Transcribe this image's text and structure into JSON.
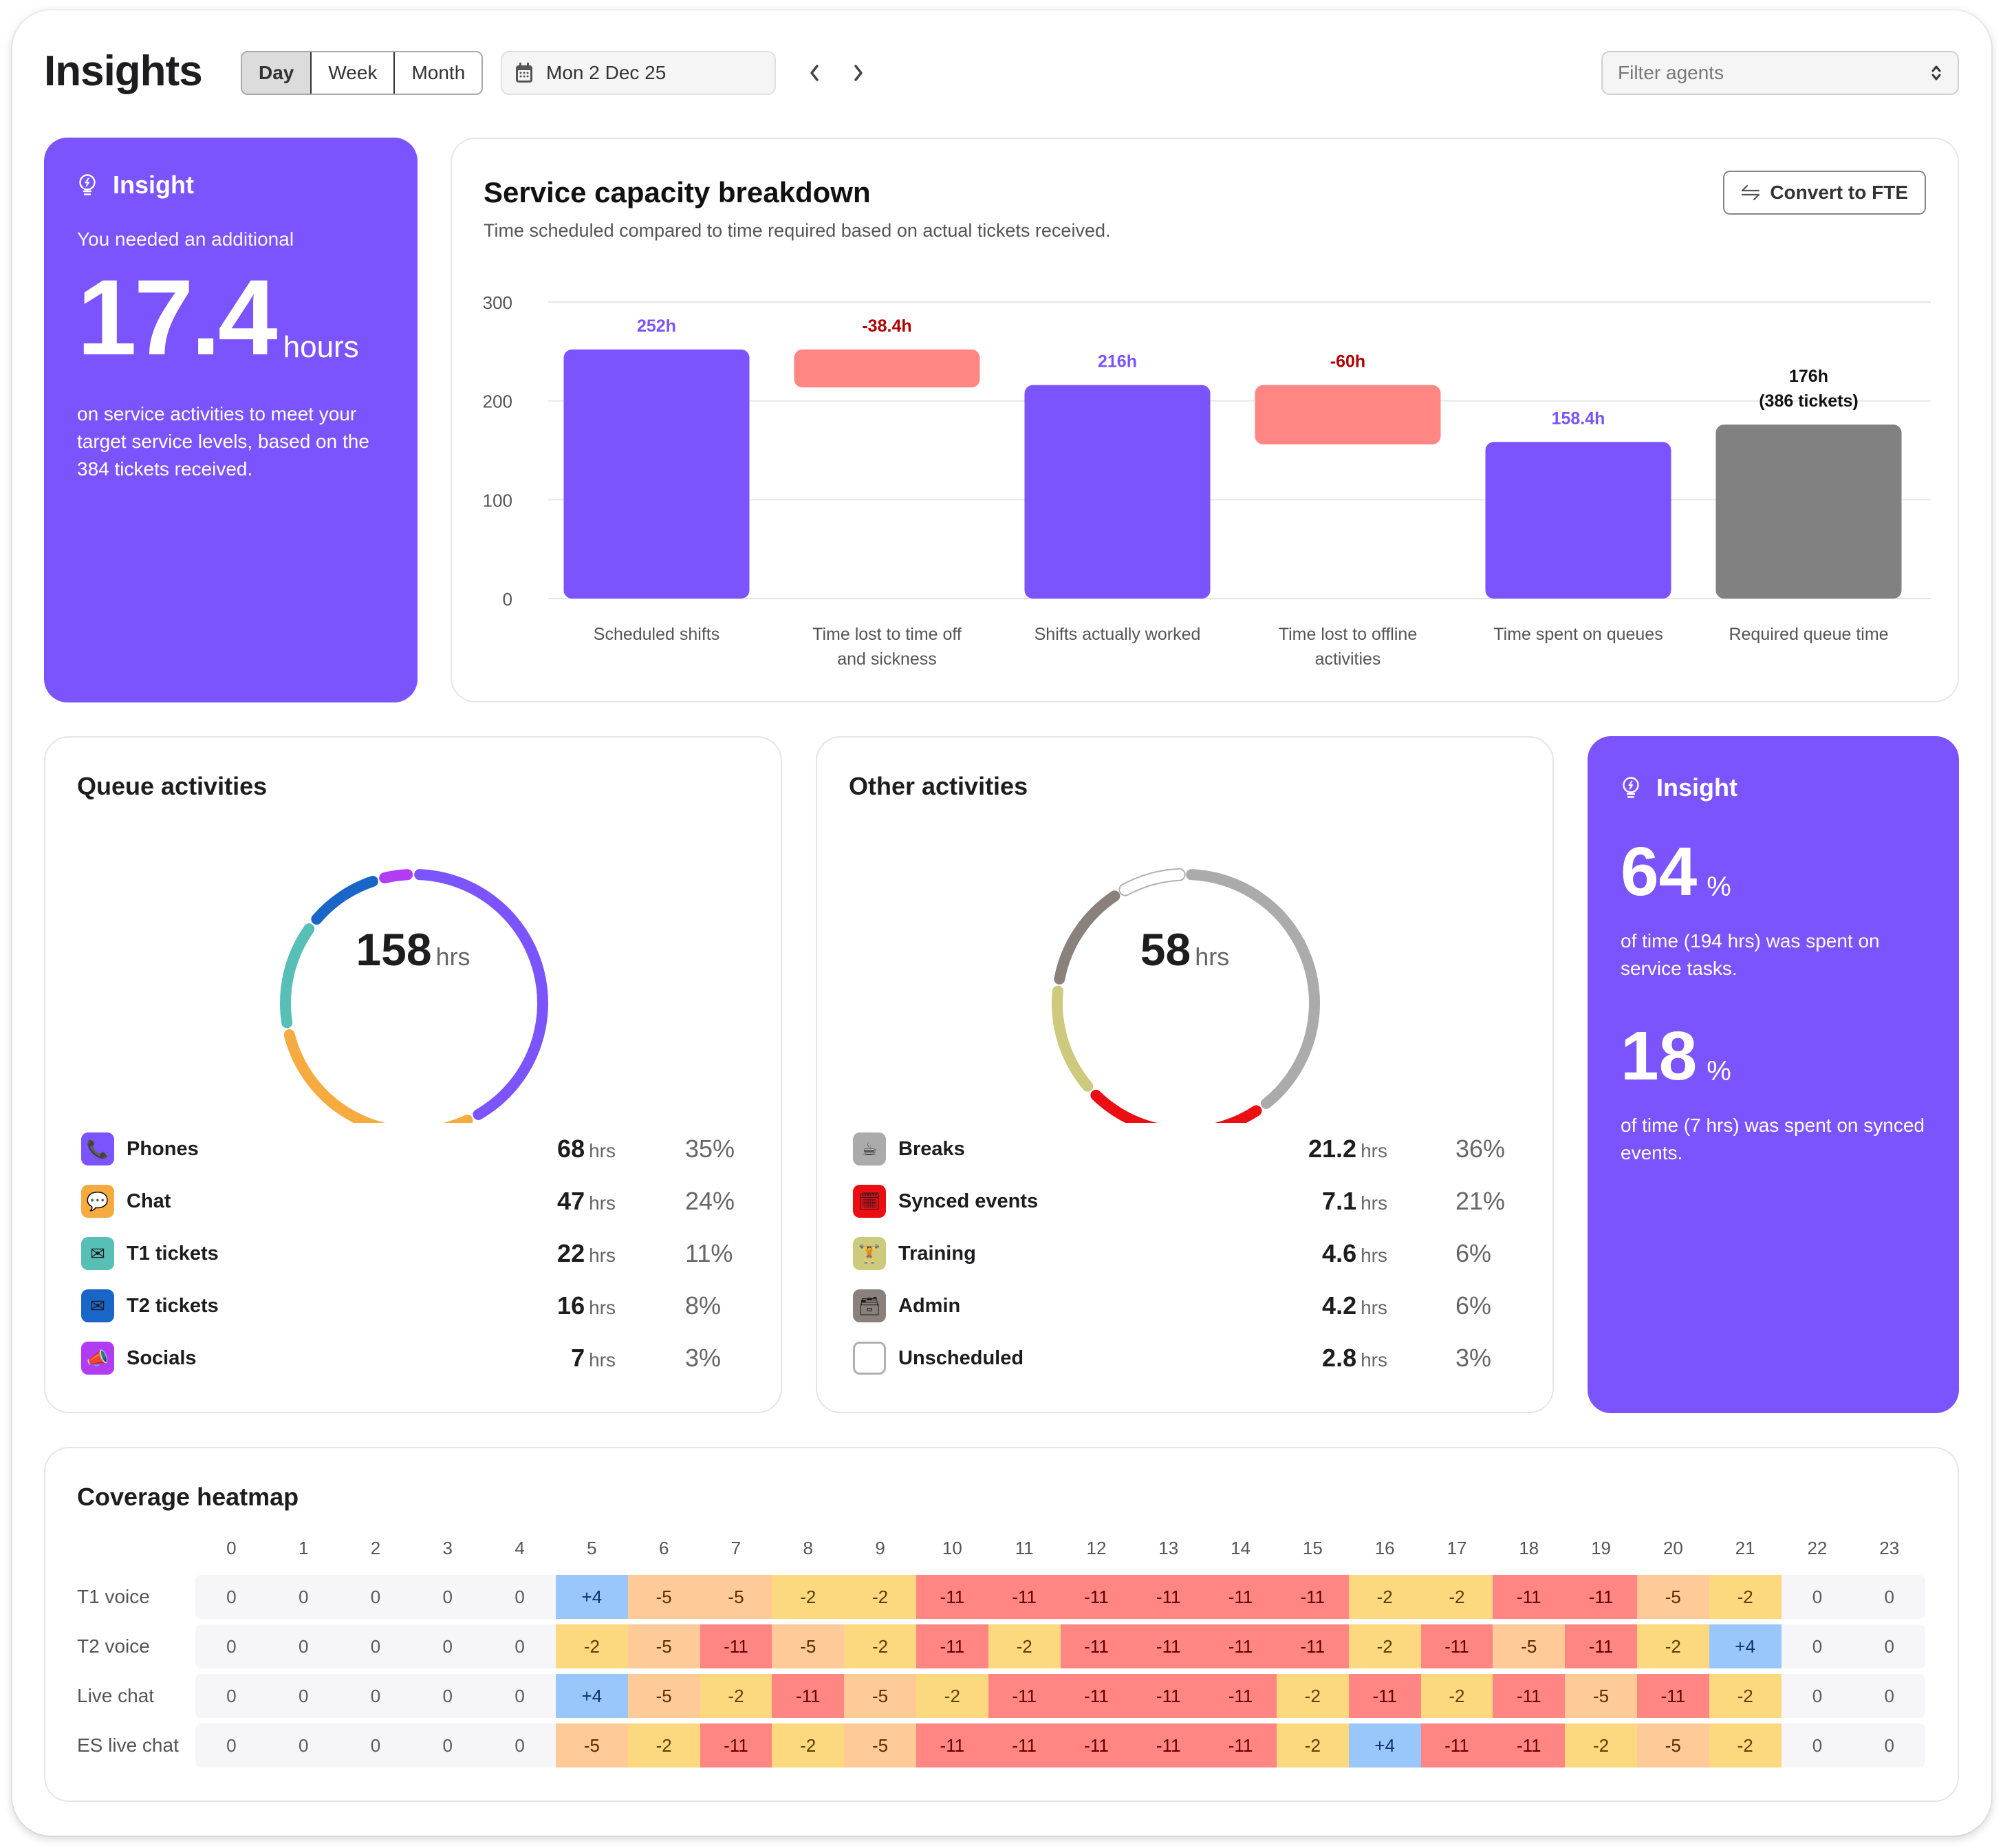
{
  "header": {
    "title": "Insights",
    "period_tabs": [
      {
        "label": "Day",
        "active": true
      },
      {
        "label": "Week",
        "active": false
      },
      {
        "label": "Month",
        "active": false
      }
    ],
    "date": "Mon 2 Dec 25",
    "prev_icon": "chevron-left-icon",
    "next_icon": "chevron-right-icon",
    "filter_placeholder": "Filter agents"
  },
  "insight_card_1": {
    "title": "Insight",
    "icon": "lightbulb-icon",
    "lead": "You needed an additional",
    "value": "17.4",
    "unit": "hours",
    "description": "on service activities to meet your target service levels, based on the 384 tickets received."
  },
  "capacity": {
    "title": "Service capacity breakdown",
    "subtitle": "Time scheduled compared to time required based on actual tickets received.",
    "convert_button": "Convert to FTE",
    "colors": {
      "positive": "#7b54fd",
      "loss": "#ff8682",
      "required": "#818181",
      "loss_label": "#b00000",
      "positive_label": "#7b54fd",
      "required_label": "#111111"
    }
  },
  "chart_data": {
    "type": "bar",
    "subtype": "waterfall",
    "title": "Service capacity breakdown",
    "ylabel": "",
    "xlabel": "",
    "ylim": [
      0,
      300
    ],
    "yticks": [
      0,
      100,
      200,
      300
    ],
    "grid": true,
    "categories": [
      "Scheduled shifts",
      "Time lost to time off and sickness",
      "Shifts actually worked",
      "Time lost to offline activities",
      "Time spent on queues",
      "Required queue time"
    ],
    "category_lines": [
      [
        "Scheduled shifts"
      ],
      [
        "Time lost to time off",
        "and sickness"
      ],
      [
        "Shifts actually worked"
      ],
      [
        "Time lost to offline",
        "activities"
      ],
      [
        "Time spent on queues"
      ],
      [
        "Required queue time"
      ]
    ],
    "bars": [
      {
        "kind": "total",
        "start": 0,
        "end": 252,
        "label": [
          "252h"
        ]
      },
      {
        "kind": "loss",
        "start": 252,
        "end": 213.6,
        "label": [
          "-38.4h"
        ]
      },
      {
        "kind": "total",
        "start": 0,
        "end": 216,
        "label": [
          "216h"
        ]
      },
      {
        "kind": "loss",
        "start": 216,
        "end": 156,
        "label": [
          "-60h"
        ]
      },
      {
        "kind": "total",
        "start": 0,
        "end": 158.4,
        "label": [
          "158.4h"
        ]
      },
      {
        "kind": "required",
        "start": 0,
        "end": 176,
        "label": [
          "176h",
          "(386 tickets)"
        ]
      }
    ]
  },
  "queue_activities": {
    "title": "Queue activities",
    "total": "158",
    "unit": "hrs",
    "items": [
      {
        "label": "Phones",
        "hours": "68",
        "pct": "35%",
        "value": 68,
        "color": "#7b54fd",
        "icon": "phone-icon",
        "glyph": "📞"
      },
      {
        "label": "Chat",
        "hours": "47",
        "pct": "24%",
        "value": 47,
        "color": "#f5ab3f",
        "icon": "chat-bubble-icon",
        "glyph": "💬"
      },
      {
        "label": "T1 tickets",
        "hours": "22",
        "pct": "11%",
        "value": 22,
        "color": "#58bfb7",
        "icon": "envelope-icon",
        "glyph": "✉"
      },
      {
        "label": "T2 tickets",
        "hours": "16",
        "pct": "8%",
        "value": 16,
        "color": "#1966c8",
        "icon": "envelope-icon",
        "glyph": "✉"
      },
      {
        "label": "Socials",
        "hours": "7",
        "pct": "3%",
        "value": 7,
        "color": "#b13cf3",
        "icon": "megaphone-icon",
        "glyph": "📣"
      }
    ]
  },
  "other_activities": {
    "title": "Other activities",
    "total": "58",
    "unit": "hrs",
    "items": [
      {
        "label": "Breaks",
        "hours": "21.2",
        "pct": "36%",
        "value": 21.2,
        "color": "#ababab",
        "icon": "coffee-icon",
        "glyph": "☕"
      },
      {
        "label": "Synced events",
        "hours": "7.1",
        "pct": "21%",
        "value": 12.2,
        "color": "#eb0e13",
        "icon": "calendar-icon",
        "glyph": "🗓"
      },
      {
        "label": "Training",
        "hours": "4.6",
        "pct": "6%",
        "value": 7.5,
        "color": "#cdc97d",
        "icon": "weightlifter-icon",
        "glyph": "🏋"
      },
      {
        "label": "Admin",
        "hours": "4.2",
        "pct": "6%",
        "value": 7.5,
        "color": "#8a817c",
        "icon": "card-box-icon",
        "glyph": "🗃"
      },
      {
        "label": "Unscheduled",
        "hours": "2.8",
        "pct": "3%",
        "value": 4.5,
        "color": "#ffffff",
        "outline": "#b0b0b0",
        "icon": "empty-square-icon",
        "glyph": ""
      }
    ]
  },
  "insight_card_2": {
    "title": "Insight",
    "icon": "lightbulb-icon",
    "stat1_value": "64",
    "stat1_unit": "%",
    "stat1_desc": "of time (194 hrs) was spent on service tasks.",
    "stat2_value": "18",
    "stat2_unit": "%",
    "stat2_desc": "of time (7 hrs) was spent on synced events."
  },
  "heatmap": {
    "title": "Coverage heatmap",
    "hours": [
      "0",
      "1",
      "2",
      "3",
      "4",
      "5",
      "6",
      "7",
      "8",
      "9",
      "10",
      "11",
      "12",
      "13",
      "14",
      "15",
      "16",
      "17",
      "18",
      "19",
      "20",
      "21",
      "22",
      "23"
    ],
    "colors": {
      "zero": {
        "bg": "transparent",
        "fg": "#5a5a5e"
      },
      "+4": {
        "bg": "#9ac7fb",
        "fg": "#0c2f70"
      },
      "-2": {
        "bg": "#fcd97f",
        "fg": "#5a4000"
      },
      "-5": {
        "bg": "#fdca98",
        "fg": "#5a2c00"
      },
      "-11": {
        "bg": "#ff8682",
        "fg": "#5e0000"
      }
    },
    "rows": [
      {
        "label": "T1 voice",
        "values": [
          "0",
          "0",
          "0",
          "0",
          "0",
          "+4",
          "-5",
          "-5",
          "-2",
          "-2",
          "-11",
          "-11",
          "-11",
          "-11",
          "-11",
          "-11",
          "-2",
          "-2",
          "-11",
          "-11",
          "-5",
          "-2",
          "0",
          "0"
        ]
      },
      {
        "label": "T2 voice",
        "values": [
          "0",
          "0",
          "0",
          "0",
          "0",
          "-2",
          "-5",
          "-11",
          "-5",
          "-2",
          "-11",
          "-2",
          "-11",
          "-11",
          "-11",
          "-11",
          "-2",
          "-11",
          "-5",
          "-11",
          "-2",
          "+4",
          "0",
          "0"
        ]
      },
      {
        "label": "Live chat",
        "values": [
          "0",
          "0",
          "0",
          "0",
          "0",
          "+4",
          "-5",
          "-2",
          "-11",
          "-5",
          "-2",
          "-11",
          "-11",
          "-11",
          "-11",
          "-2",
          "-11",
          "-2",
          "-11",
          "-5",
          "-11",
          "-2",
          "0",
          "0"
        ]
      },
      {
        "label": "ES live chat",
        "values": [
          "0",
          "0",
          "0",
          "0",
          "0",
          "-5",
          "-2",
          "-11",
          "-2",
          "-5",
          "-11",
          "-11",
          "-11",
          "-11",
          "-11",
          "-2",
          "+4",
          "-11",
          "-11",
          "-2",
          "-5",
          "-2",
          "0",
          "0"
        ]
      }
    ]
  }
}
